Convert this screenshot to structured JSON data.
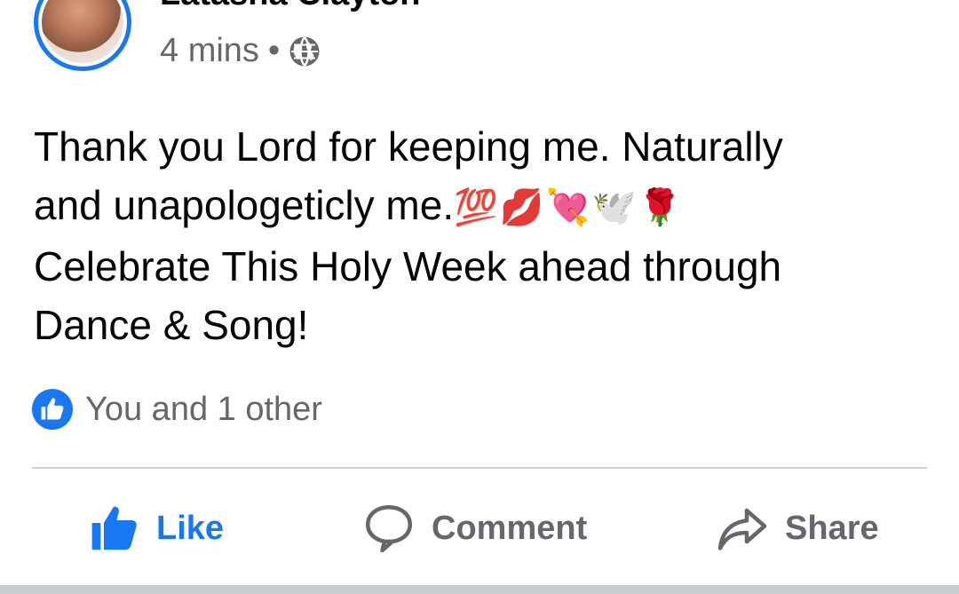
{
  "post": {
    "author_name": "Latasha Clayton",
    "time": "4 mins",
    "separator": "•",
    "privacy_icon": "globe-icon",
    "text_lines": [
      "Thank you Lord for keeping me. Naturally",
      "and unapologeticly me.",
      "Celebrate This Holy Week ahead through",
      "Dance & Song!"
    ],
    "emojis": "💯💋💘🕊️🌹"
  },
  "reactions": {
    "icon": "like-badge-icon",
    "text": "You and 1 other"
  },
  "actions": {
    "like": "Like",
    "comment": "Comment",
    "share": "Share"
  },
  "colors": {
    "accent": "#1877f2",
    "secondary_text": "#65676b",
    "divider": "#ced0d4"
  }
}
